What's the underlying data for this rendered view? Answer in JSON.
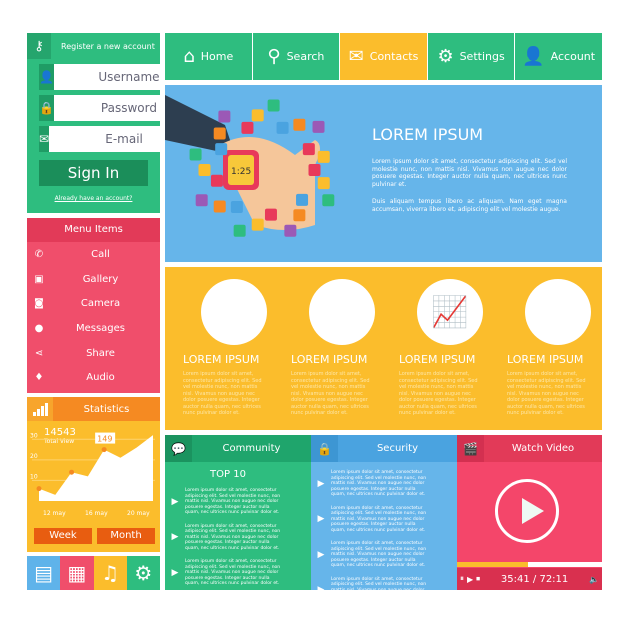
{
  "register": {
    "title": "Register a new account",
    "icon": "key-icon",
    "username_placeholder": "Username",
    "password_placeholder": "Password",
    "email_placeholder": "E-mail",
    "sign_in": "Sign In",
    "already": "Already have an account?"
  },
  "menu": {
    "title": "Menu Items",
    "items": [
      {
        "label": "Call",
        "icon": "phone-icon"
      },
      {
        "label": "Gallery",
        "icon": "image-icon"
      },
      {
        "label": "Camera",
        "icon": "camera-icon"
      },
      {
        "label": "Messages",
        "icon": "chat-icon"
      },
      {
        "label": "Share",
        "icon": "share-icon"
      },
      {
        "label": "Audio",
        "icon": "microphone-icon"
      }
    ]
  },
  "stats": {
    "title": "Statistics",
    "total": "14543",
    "total_label": "Total View",
    "week": "Week",
    "month": "Month",
    "callout": "149"
  },
  "chart_data": {
    "type": "area",
    "x": [
      "12 may",
      "",
      "",
      "16 may",
      "",
      "",
      "20 may",
      ""
    ],
    "values": [
      6,
      3,
      14,
      12,
      25,
      21,
      26,
      32
    ],
    "yticks": [
      10,
      20,
      30
    ],
    "ylim": [
      0,
      35
    ],
    "xticks": [
      "12 may",
      "16 may",
      "20 may"
    ],
    "highlight": "149",
    "color": "#ffffff"
  },
  "strip": [
    {
      "icon": "document-icon",
      "color": "#5fb3ea"
    },
    {
      "icon": "photos-icon",
      "color": "#f04e6b"
    },
    {
      "icon": "music-icon",
      "color": "#fbbd2c"
    },
    {
      "icon": "gear-icon",
      "color": "#2ebd7f"
    }
  ],
  "nav": [
    {
      "label": "Home",
      "icon": "home-icon"
    },
    {
      "label": "Search",
      "icon": "search-icon"
    },
    {
      "label": "Contacts",
      "icon": "envelope-icon",
      "active": true
    },
    {
      "label": "Settings",
      "icon": "gear-icon"
    },
    {
      "label": "Account",
      "icon": "user-icon"
    }
  ],
  "hero": {
    "title": "LOREM IPSUM",
    "p1": "Lorem ipsum dolor sit amet, consectetur adipiscing elit. Sed vel molestie nunc, non mattis nisl. Vivamus non augue nec dolor posuere egestas. Integer auctor nulla quam, nec ultrices nunc pulvinar et.",
    "p2": "Duis aliquam tempus libero ac aliquam.  Nam eget magna accumsan, viverra libero et, adipiscing elit vel molestie augue.",
    "watch_time": "1:25"
  },
  "features": [
    {
      "icon": "target-icon",
      "title": "LOREM IPSUM",
      "text": "Lorem ipsum dolor sit amet, consectetur adipiscing elit. Sed vel molestie nunc, non mattis nisl. Vivamus non augue nec dolor posuere egestas. Integer auctor nulla quam, nec ultrices nunc pulvinar dolor et."
    },
    {
      "icon": "calendar-icon",
      "title": "LOREM IPSUM",
      "text": "Lorem ipsum dolor sit amet, consectetur adipiscing elit. Sed vel molestie nunc, non mattis nisl. Vivamus non augue nec dolor posuere egestas. Integer auctor nulla quam, nec ultrices nunc pulvinar dolor et."
    },
    {
      "icon": "chart-board-icon",
      "title": "LOREM IPSUM",
      "text": "Lorem ipsum dolor sit amet, consectetur adipiscing elit. Sed vel molestie nunc, non mattis nisl. Vivamus non augue nec dolor posuere egestas. Integer auctor nulla quam, nec ultrices nunc pulvinar dolor et."
    },
    {
      "icon": "money-icon",
      "title": "LOREM IPSUM",
      "text": "Lorem ipsum dolor sit amet, consectetur adipiscing elit. Sed vel molestie nunc, non mattis nisl. Vivamus non augue nec dolor posuere egestas. Integer auctor nulla quam, nec ultrices nunc pulvinar dolor et."
    }
  ],
  "community": {
    "title": "Community",
    "top": "TOP 10",
    "items": [
      "Lorem ipsum dolor sit amet, consectetur adipiscing elit. Sed vel molestie nunc, non mattis nisl. Vivamus non augue nec dolor posuere egestas. Integer auctor nulla quam, nec ultrices nunc pulvinar dolor et.",
      "Lorem ipsum dolor sit amet, consectetur adipiscing elit. Sed vel molestie nunc, non mattis nisl. Vivamus non augue nec dolor posuere egestas. Integer auctor nulla quam, nec ultrices nunc pulvinar dolor et.",
      "Lorem ipsum dolor sit amet, consectetur adipiscing elit. Sed vel molestie nunc, non mattis nisl. Vivamus non augue nec dolor posuere egestas. Integer auctor nulla quam, nec ultrices nunc pulvinar dolor et."
    ]
  },
  "security": {
    "title": "Security",
    "items": [
      "Lorem ipsum dolor sit amet, consectetur adipiscing elit. Sed vel molestie nunc, non mattis nisl. Vivamus non augue nec dolor posuere egestas. Integer auctor nulla quam, nec ultrices nunc pulvinar dolor et.",
      "Lorem ipsum dolor sit amet, consectetur adipiscing elit. Sed vel molestie nunc, non mattis nisl. Vivamus non augue nec dolor posuere egestas. Integer auctor nulla quam, nec ultrices nunc pulvinar dolor et.",
      "Lorem ipsum dolor sit amet, consectetur adipiscing elit. Sed vel molestie nunc, non mattis nisl. Vivamus non augue nec dolor posuere egestas. Integer auctor nulla quam, nec ultrices nunc pulvinar dolor et.",
      "Lorem ipsum dolor sit amet, consectetur adipiscing elit. Sed vel molestie nunc, non mattis nisl. Vivamus non augue nec dolor posuere egestas. Integer auctor nulla quam, nec ultrices nunc pulvinar dolor et."
    ]
  },
  "video": {
    "title": "Watch Video",
    "time": "35:41 / 72:11",
    "progress": 0.49
  }
}
